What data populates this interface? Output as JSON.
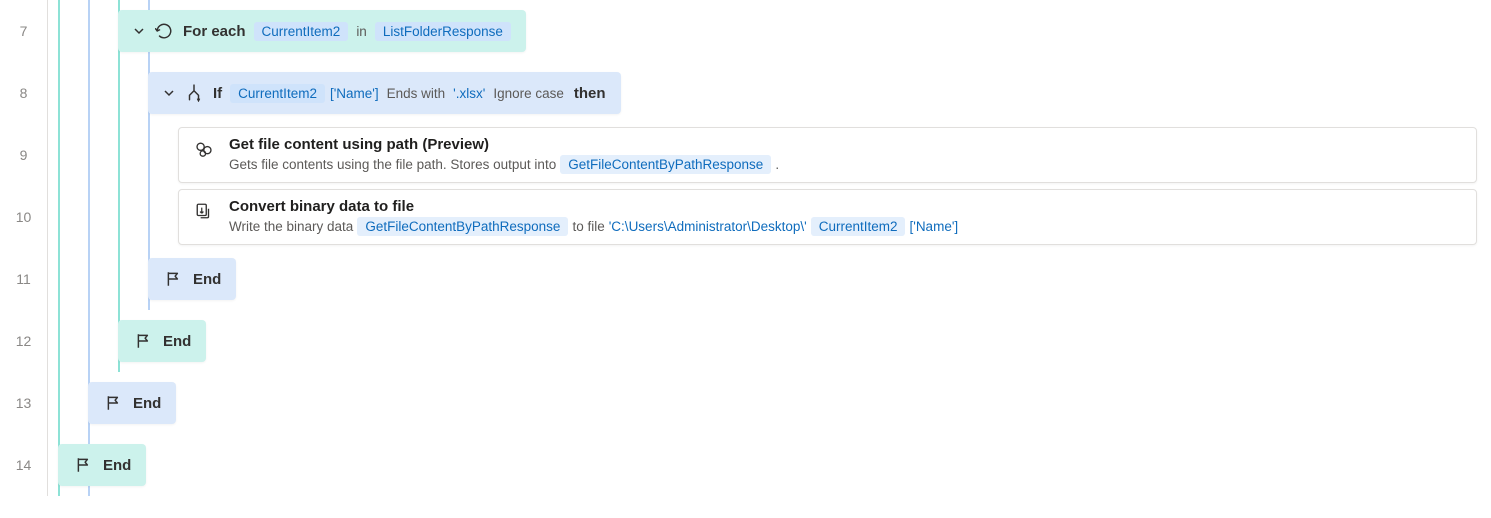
{
  "lines": [
    "7",
    "8",
    "9",
    "10",
    "11",
    "12",
    "13",
    "14"
  ],
  "colors": {
    "teal": "#ccf2ec",
    "blue": "#dbe8fa"
  },
  "foreach": {
    "kw": "For each",
    "var": "CurrentItem2",
    "in": "in",
    "list": "ListFolderResponse"
  },
  "if": {
    "kw": "If",
    "var": "CurrentItem2",
    "prop": "['Name']",
    "cond1": "Ends with",
    "literal": "'.xlsx'",
    "cond2": "Ignore case",
    "then": "then"
  },
  "step1": {
    "title": "Get file content using path (Preview)",
    "pre": "Gets file contents using the file path. Stores output into",
    "out": "GetFileContentByPathResponse",
    "post": "."
  },
  "step2": {
    "title": "Convert binary data to file",
    "pre": "Write the binary data",
    "in": "GetFileContentByPathResponse",
    "mid": "to file",
    "path": "'C:\\Users\\Administrator\\Desktop\\'",
    "var": "CurrentItem2",
    "prop": "['Name']"
  },
  "end": "End"
}
